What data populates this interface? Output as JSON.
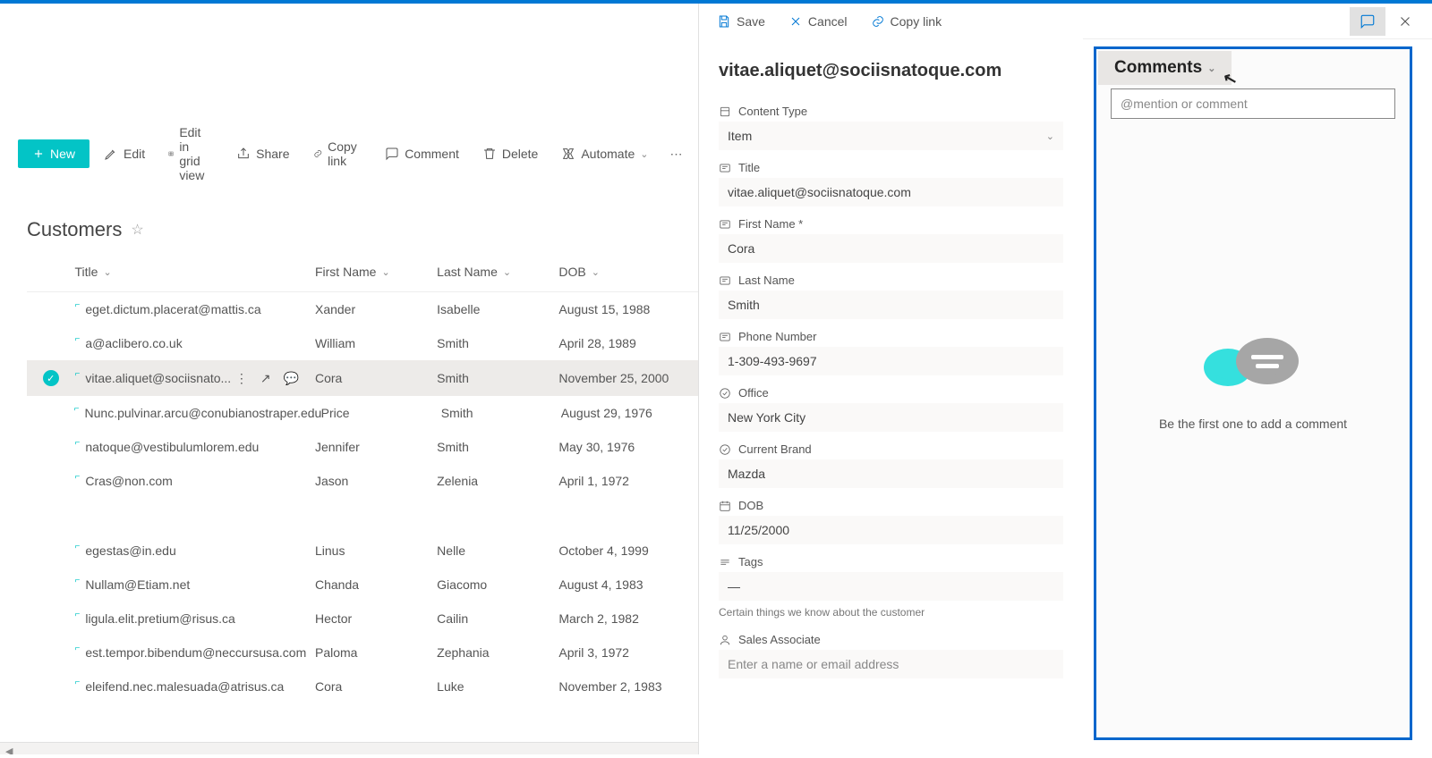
{
  "toolbar": {
    "new_label": "New",
    "edit_label": "Edit",
    "grid_label": "Edit in grid view",
    "share_label": "Share",
    "copy_link_label": "Copy link",
    "comment_label": "Comment",
    "delete_label": "Delete",
    "automate_label": "Automate"
  },
  "list": {
    "title": "Customers",
    "columns": {
      "title": "Title",
      "first_name": "First Name",
      "last_name": "Last Name",
      "dob": "DOB"
    },
    "rows": [
      {
        "title": "eget.dictum.placerat@mattis.ca",
        "fn": "Xander",
        "ln": "Isabelle",
        "dob": "August 15, 1988"
      },
      {
        "title": "a@aclibero.co.uk",
        "fn": "William",
        "ln": "Smith",
        "dob": "April 28, 1989"
      },
      {
        "title": "vitae.aliquet@sociisnato...",
        "fn": "Cora",
        "ln": "Smith",
        "dob": "November 25, 2000"
      },
      {
        "title": "Nunc.pulvinar.arcu@conubianostraper.edu",
        "fn": "Price",
        "ln": "Smith",
        "dob": "August 29, 1976"
      },
      {
        "title": "natoque@vestibulumlorem.edu",
        "fn": "Jennifer",
        "ln": "Smith",
        "dob": "May 30, 1976"
      },
      {
        "title": "Cras@non.com",
        "fn": "Jason",
        "ln": "Zelenia",
        "dob": "April 1, 1972"
      },
      {
        "title": "egestas@in.edu",
        "fn": "Linus",
        "ln": "Nelle",
        "dob": "October 4, 1999"
      },
      {
        "title": "Nullam@Etiam.net",
        "fn": "Chanda",
        "ln": "Giacomo",
        "dob": "August 4, 1983"
      },
      {
        "title": "ligula.elit.pretium@risus.ca",
        "fn": "Hector",
        "ln": "Cailin",
        "dob": "March 2, 1982"
      },
      {
        "title": "est.tempor.bibendum@neccursusa.com",
        "fn": "Paloma",
        "ln": "Zephania",
        "dob": "April 3, 1972"
      },
      {
        "title": "eleifend.nec.malesuada@atrisus.ca",
        "fn": "Cora",
        "ln": "Luke",
        "dob": "November 2, 1983"
      }
    ],
    "selected_index": 2
  },
  "detail": {
    "toolbar": {
      "save": "Save",
      "cancel": "Cancel",
      "copy_link": "Copy link"
    },
    "title": "vitae.aliquet@sociisnatoque.com",
    "fields": {
      "content_type_label": "Content Type",
      "content_type_value": "Item",
      "title_label": "Title",
      "title_value": "vitae.aliquet@sociisnatoque.com",
      "first_name_label": "First Name *",
      "first_name_value": "Cora",
      "last_name_label": "Last Name",
      "last_name_value": "Smith",
      "phone_label": "Phone Number",
      "phone_value": "1-309-493-9697",
      "office_label": "Office",
      "office_value": "New York City",
      "brand_label": "Current Brand",
      "brand_value": "Mazda",
      "dob_label": "DOB",
      "dob_value": "11/25/2000",
      "tags_label": "Tags",
      "tags_value": "—",
      "tags_descr": "Certain things we know about the customer",
      "assoc_label": "Sales Associate",
      "assoc_placeholder": "Enter a name or email address"
    }
  },
  "comments": {
    "header": "Comments",
    "input_placeholder": "@mention or comment",
    "empty": "Be the first one to add a comment"
  }
}
